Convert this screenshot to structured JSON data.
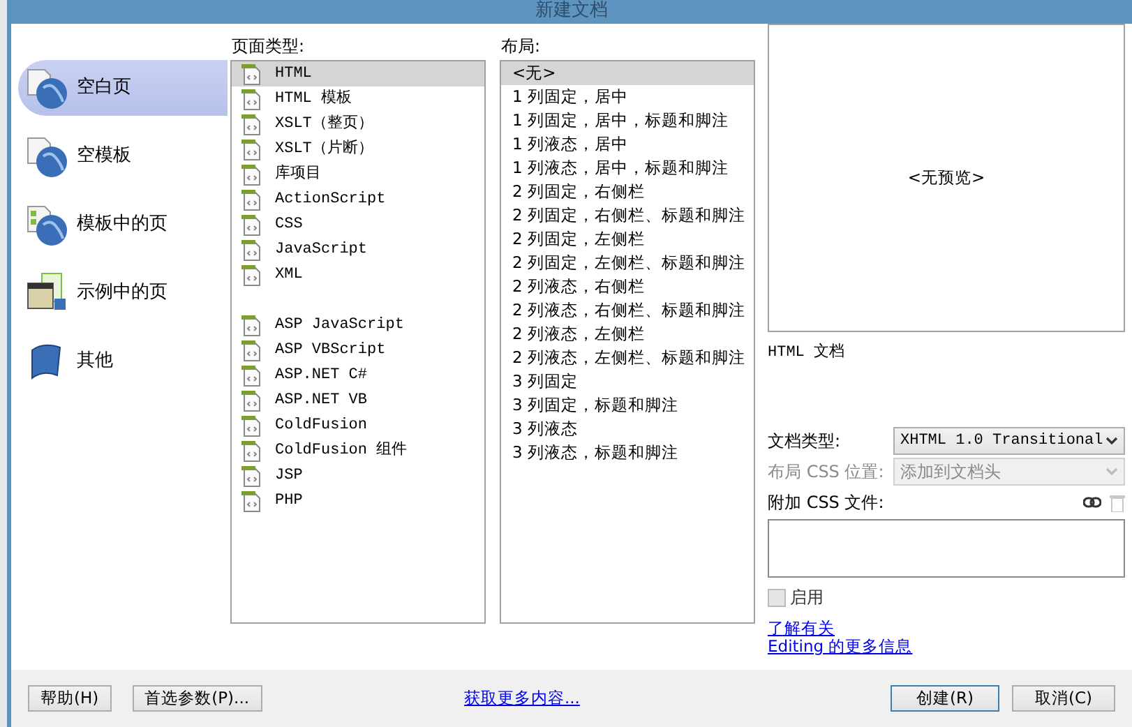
{
  "window": {
    "title": "新建文档"
  },
  "categories": [
    {
      "label": "空白页",
      "kind": "blank",
      "selected": true
    },
    {
      "label": "空模板",
      "kind": "template",
      "selected": false
    },
    {
      "label": "模板中的页",
      "kind": "template_page",
      "selected": false
    },
    {
      "label": "示例中的页",
      "kind": "sample",
      "selected": false
    },
    {
      "label": "其他",
      "kind": "other",
      "selected": false
    }
  ],
  "page_types": {
    "label": "页面类型:",
    "groups": [
      [
        {
          "label": "HTML",
          "selected": true
        },
        {
          "label": "HTML 模板",
          "selected": false
        },
        {
          "label": "XSLT（整页）",
          "selected": false
        },
        {
          "label": "XSLT（片断）",
          "selected": false
        },
        {
          "label": "库项目",
          "selected": false
        },
        {
          "label": "ActionScript",
          "selected": false
        },
        {
          "label": "CSS",
          "selected": false
        },
        {
          "label": "JavaScript",
          "selected": false
        },
        {
          "label": "XML",
          "selected": false
        }
      ],
      [
        {
          "label": "ASP JavaScript",
          "selected": false
        },
        {
          "label": "ASP VBScript",
          "selected": false
        },
        {
          "label": "ASP.NET C#",
          "selected": false
        },
        {
          "label": "ASP.NET VB",
          "selected": false
        },
        {
          "label": "ColdFusion",
          "selected": false
        },
        {
          "label": "ColdFusion 组件",
          "selected": false
        },
        {
          "label": "JSP",
          "selected": false
        },
        {
          "label": "PHP",
          "selected": false
        }
      ]
    ]
  },
  "layouts": {
    "label": "布局:",
    "items": [
      {
        "label": "<无>",
        "selected": true
      },
      {
        "label": "1 列固定，居中",
        "selected": false
      },
      {
        "label": "1 列固定，居中，标题和脚注",
        "selected": false
      },
      {
        "label": "1 列液态，居中",
        "selected": false
      },
      {
        "label": "1 列液态，居中，标题和脚注",
        "selected": false
      },
      {
        "label": "2 列固定，右侧栏",
        "selected": false
      },
      {
        "label": "2 列固定，右侧栏、标题和脚注",
        "selected": false
      },
      {
        "label": "2 列固定，左侧栏",
        "selected": false
      },
      {
        "label": "2 列固定，左侧栏、标题和脚注",
        "selected": false
      },
      {
        "label": "2 列液态，右侧栏",
        "selected": false
      },
      {
        "label": "2 列液态，右侧栏、标题和脚注",
        "selected": false
      },
      {
        "label": "2 列液态，左侧栏",
        "selected": false
      },
      {
        "label": "2 列液态，左侧栏、标题和脚注",
        "selected": false
      },
      {
        "label": "3 列固定",
        "selected": false
      },
      {
        "label": "3 列固定，标题和脚注",
        "selected": false
      },
      {
        "label": "3 列液态",
        "selected": false
      },
      {
        "label": "3 列液态，标题和脚注",
        "selected": false
      }
    ]
  },
  "preview": {
    "text": "<无预览>",
    "description": "HTML 文档"
  },
  "fields": [
    {
      "label": "文档类型:",
      "value": "XHTML 1.0 Transitional",
      "disabled": false
    },
    {
      "label": "布局 CSS 位置:",
      "value": "添加到文档头",
      "disabled": true
    }
  ],
  "attach_css": {
    "label": "附加 CSS 文件:",
    "enable": {
      "label": "启用",
      "checked": false
    }
  },
  "learn_more": [
    "了解有关",
    "Editing 的更多信息"
  ],
  "footer": {
    "help": "帮助(H)",
    "preferences": "首选参数(P)...",
    "more_link": "获取更多内容...",
    "create": "创建(R)",
    "cancel": "取消(C)"
  }
}
